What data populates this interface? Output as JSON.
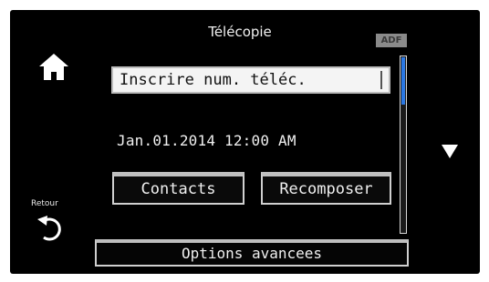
{
  "header": {
    "title": "Télécopie",
    "adf_badge": "ADF"
  },
  "fax": {
    "number_input_value": "Inscrire num. téléc."
  },
  "status": {
    "datetime": "Jan.01.2014  12:00 AM"
  },
  "buttons": {
    "contacts": "Contacts",
    "redial": "Recomposer",
    "advanced_options": "Options avancees"
  },
  "nav": {
    "back_label": "Retour"
  },
  "icons": {
    "home": "home-icon",
    "back": "back-arrow-icon",
    "scroll_down": "down-triangle-icon"
  },
  "colors": {
    "background": "#000000",
    "text": "#f0f0f0",
    "scroll_accent": "#2b78e4"
  }
}
